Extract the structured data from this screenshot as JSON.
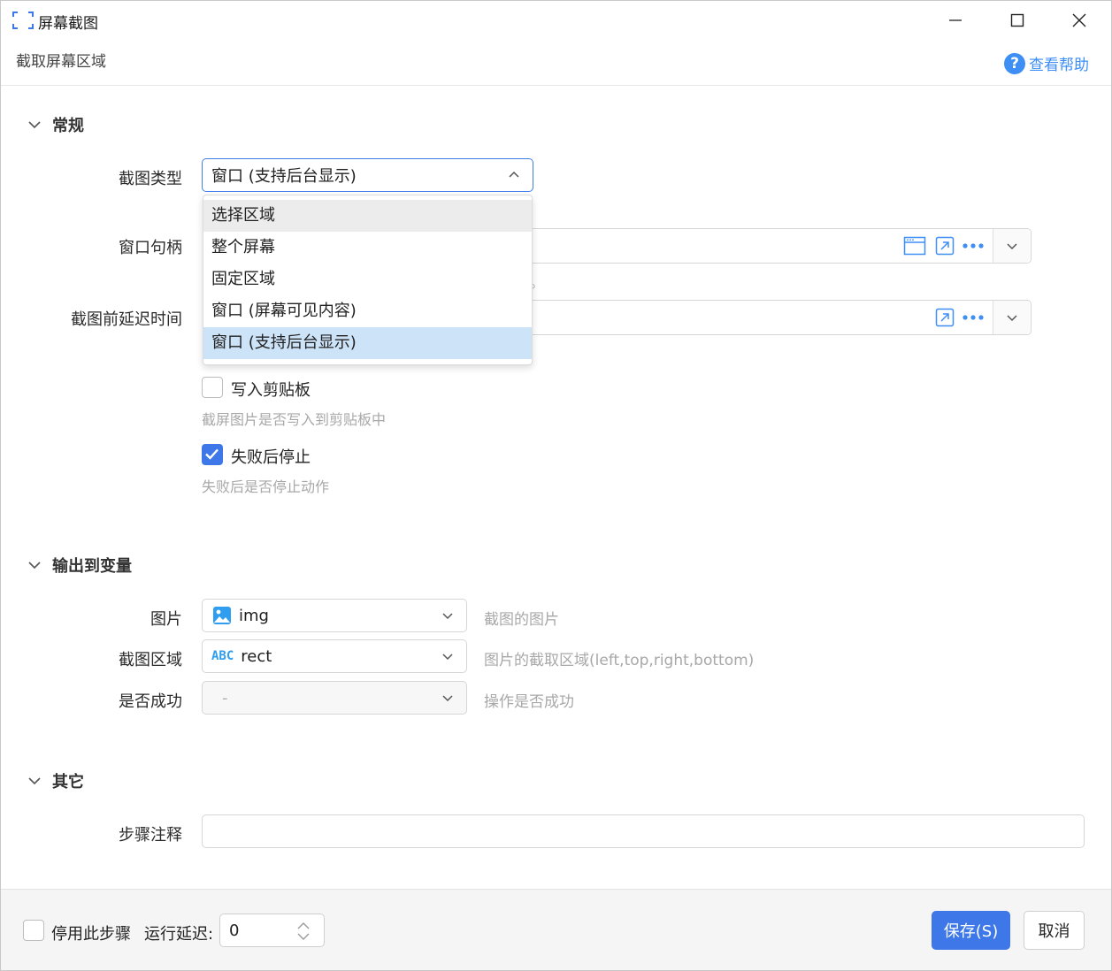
{
  "window": {
    "title": "屏幕截图",
    "subtitle": "截取屏幕区域",
    "help_label": "查看帮助",
    "help_glyph": "?"
  },
  "sections": {
    "general": "常规",
    "output": "输出到变量",
    "other": "其它"
  },
  "general": {
    "capture_type_label": "截图类型",
    "capture_type_value": "窗口 (支持后台显示)",
    "window_handle_label": "窗口句柄",
    "window_handle_hint_tail": "。",
    "delay_label": "截图前延迟时间",
    "dropdown_options": [
      "选择区域",
      "整个屏幕",
      "固定区域",
      "窗口 (屏幕可见内容)",
      "窗口 (支持后台显示)"
    ],
    "clipboard_label": "写入剪贴板",
    "clipboard_hint": "截屏图片是否写入到剪贴板中",
    "clipboard_checked": false,
    "stop_label": "失败后停止",
    "stop_hint": "失败后是否停止动作",
    "stop_checked": true
  },
  "output": {
    "image_label": "图片",
    "image_var": "img",
    "image_hint": "截图的图片",
    "region_label": "截图区域",
    "region_type": "ABC",
    "region_var": "rect",
    "region_hint": "图片的截取区域(left,top,right,bottom)",
    "success_label": "是否成功",
    "success_var": "-",
    "success_hint": "操作是否成功"
  },
  "other": {
    "comment_label": "步骤注释",
    "comment_value": ""
  },
  "footer": {
    "disable_label": "停用此步骤",
    "run_delay_label": "运行延迟:",
    "run_delay_value": "0",
    "save_label": "保存(S)",
    "cancel_label": "取消"
  },
  "colors": {
    "accent": "#3d77e8",
    "link": "#3d8ef5",
    "selected_item": "#cde3f8"
  }
}
